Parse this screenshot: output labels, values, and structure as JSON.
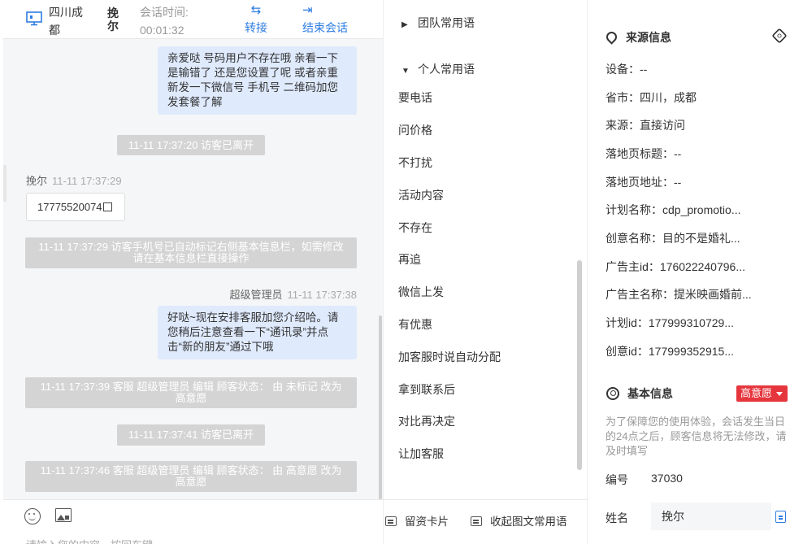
{
  "header": {
    "location": "四川成都",
    "visitor_name": "挽尔",
    "session_time_label": "会话时间:",
    "session_time": "00:01:32",
    "transfer_label": "转接",
    "end_label": "结束会话"
  },
  "messages": {
    "m1": "亲爱哒 号码用户不存在哦 亲看一下是输错了 还是您设置了呢 或者亲重新发一下微信号 手机号 二维码加您发套餐了解",
    "s1": "11-11 17:37:20 访客已离开",
    "visitor_name": "挽尔",
    "visitor_time": "11-11 17:37:29",
    "phone": "17775520074",
    "s2": "11-11 17:37:29 访客手机号已自动标记右侧基本信息栏，如需修改请在基本信息栏直接操作",
    "agent_name": "超级管理员",
    "agent_time": "11-11 17:37:38",
    "m2": "好哒~现在安排客服加您介绍哈。请您稍后注意查看一下“通讯录”并点击“新的朋友”通过下哦",
    "s3": "11-11 17:37:39 客服 超级管理员 编辑 顾客状态： 由 未标记 改为 高意愿",
    "s4": "11-11 17:37:41 访客已离开",
    "s5": "11-11 17:37:46 客服 超级管理员 编辑 顾客状态： 由 高意愿 改为 高意愿"
  },
  "input": {
    "placeholder": "请输入您的内容，按回车键..."
  },
  "phrases": {
    "team_group": "团队常用语",
    "personal_group": "个人常用语",
    "items": [
      "要电话",
      "问价格",
      "不打扰",
      "活动内容",
      "不存在",
      "再追",
      "微信上发",
      "有优惠",
      "加客服时说自动分配",
      "拿到联系后",
      "对比再决定",
      "让加客服"
    ],
    "leave_card": "留资卡片",
    "collapse": "收起图文常用语"
  },
  "source": {
    "title": "来源信息",
    "fields": [
      "设备：--",
      "省市：四川，成都",
      "来源：直接访问",
      "落地页标题：--",
      "落地页地址：--",
      "计划名称：cdp_promotio...",
      "创意名称：目的不是婚礼...",
      "广告主id：176022240796...",
      "广告主名称：提米映画婚前...",
      "计划id：177999310729...",
      "创意id：177999352915..."
    ]
  },
  "basic": {
    "title": "基本信息",
    "intent": "高意愿",
    "note": "为了保障您的使用体验，会话发生当日的24点之后，顾客信息将无法修改，请及时填写",
    "number_label": "编号",
    "number_value": "37030",
    "name_label": "姓名",
    "name_value": "挽尔"
  },
  "colors": {
    "accent": "#2f7de1",
    "bubble": "#dfeafd",
    "system": "#d4d4d4",
    "intent": "#e6363d"
  }
}
